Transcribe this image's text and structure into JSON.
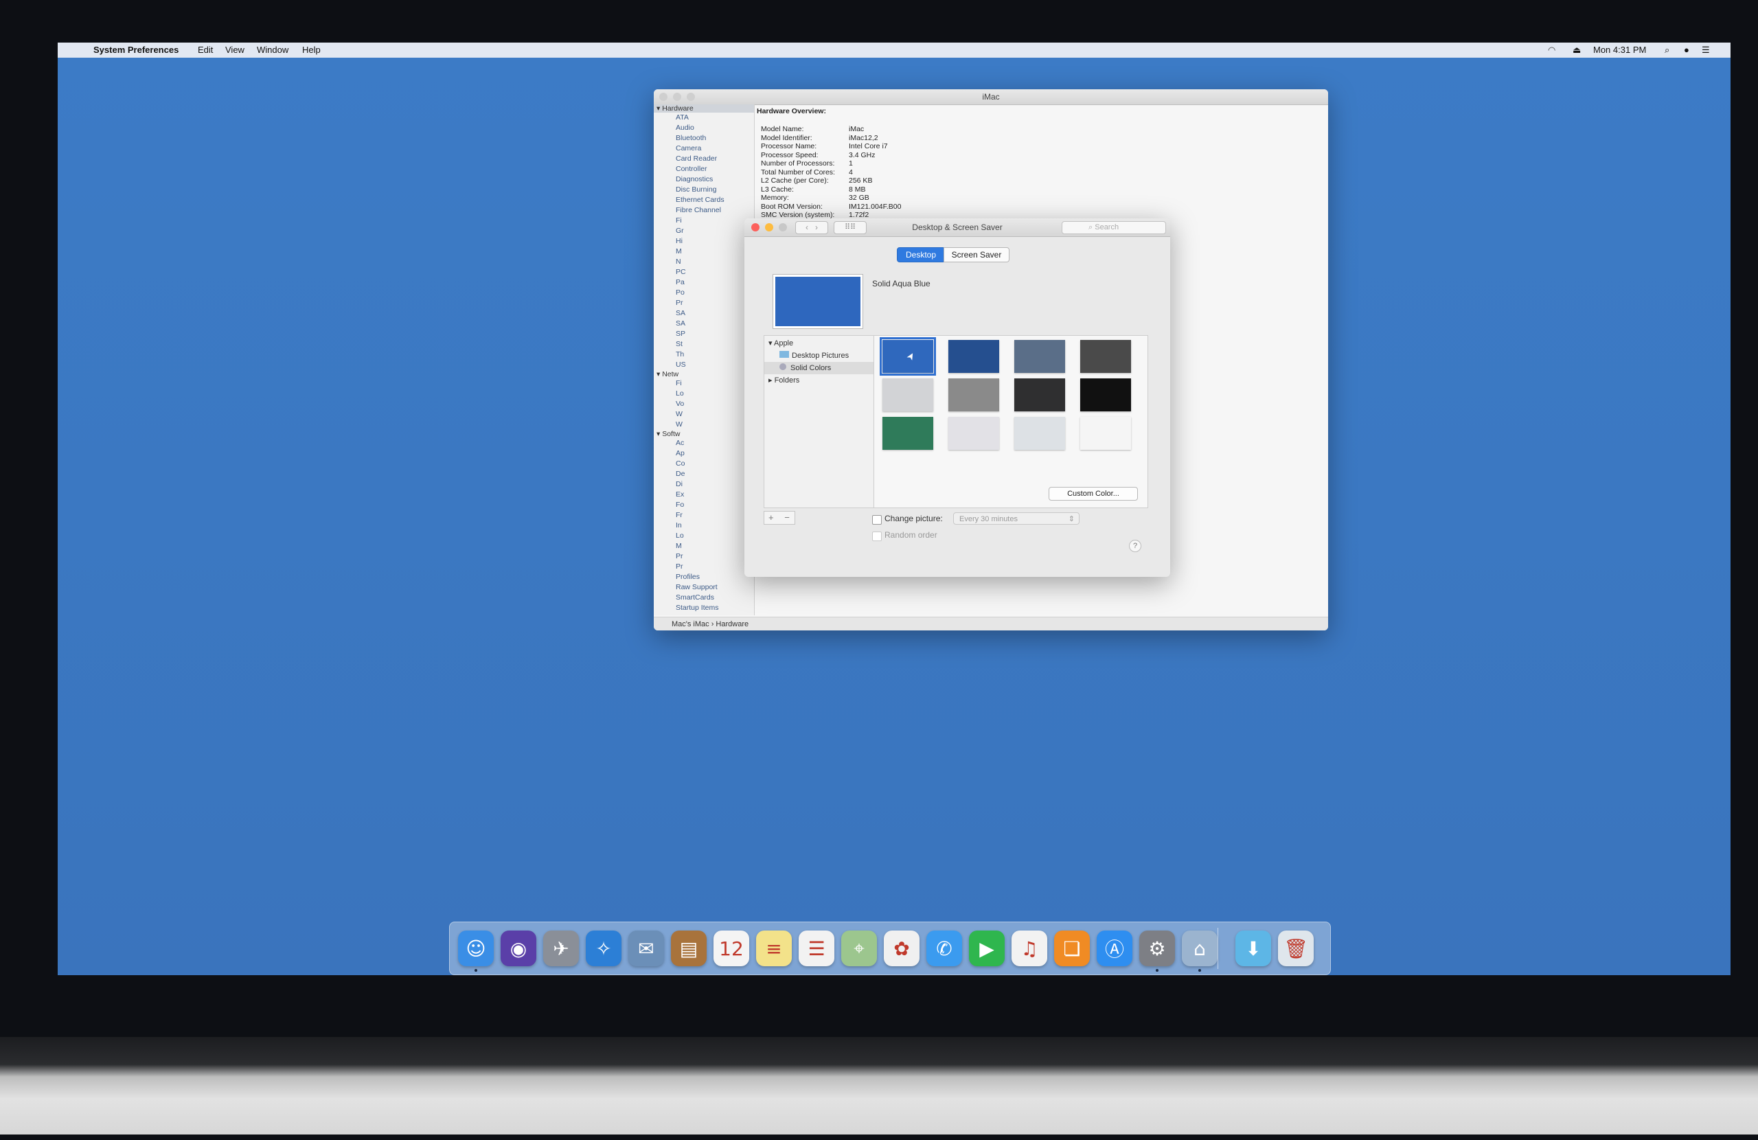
{
  "menubar": {
    "app_name": "System Preferences",
    "menus": [
      "Edit",
      "View",
      "Window",
      "Help"
    ],
    "clock": "Mon 4:31 PM"
  },
  "system_info": {
    "window_title": "iMac",
    "sidebar": {
      "hardware_header": "Hardware",
      "hardware_items": [
        "ATA",
        "Audio",
        "Bluetooth",
        "Camera",
        "Card Reader",
        "Controller",
        "Diagnostics",
        "Disc Burning",
        "Ethernet Cards",
        "Fibre Channel"
      ],
      "network_header": "Netw",
      "software_header": "Softw",
      "software_items_bottom": [
        "Profiles",
        "Raw Support",
        "SmartCards",
        "Startup Items"
      ]
    },
    "overview_title": "Hardware Overview:",
    "specs": [
      {
        "k": "Model Name:",
        "v": "iMac"
      },
      {
        "k": "Model Identifier:",
        "v": "iMac12,2"
      },
      {
        "k": "Processor Name:",
        "v": "Intel Core i7"
      },
      {
        "k": "Processor Speed:",
        "v": "3.4 GHz"
      },
      {
        "k": "Number of Processors:",
        "v": "1"
      },
      {
        "k": "Total Number of Cores:",
        "v": "4"
      },
      {
        "k": "L2 Cache (per Core):",
        "v": "256 KB"
      },
      {
        "k": "L3 Cache:",
        "v": "8 MB"
      },
      {
        "k": "Memory:",
        "v": "32 GB"
      },
      {
        "k": "Boot ROM Version:",
        "v": "IM121.004F.B00"
      },
      {
        "k": "SMC Version (system):",
        "v": "1.72f2"
      }
    ],
    "status_path": "Mac's iMac › Hardware"
  },
  "desktop_prefs": {
    "window_title": "Desktop & Screen Saver",
    "search_placeholder": "Search",
    "tabs": [
      "Desktop",
      "Screen Saver"
    ],
    "selected_name": "Solid Aqua Blue",
    "sources": {
      "apple": "Apple",
      "desktop_pictures": "Desktop Pictures",
      "solid_colors": "Solid Colors",
      "folders": "Folders"
    },
    "swatches": [
      "#2f68bd",
      "#254f8f",
      "#5a6e88",
      "#4a4a4a",
      "#d2d3d6",
      "#8a8a8a",
      "#2f2f30",
      "#111111",
      "#2f7b5a",
      "#e2e1e6",
      "#dde1e5",
      "#f5f5f5"
    ],
    "custom_color_label": "Custom Color...",
    "add_label": "+",
    "remove_label": "−",
    "change_picture_label": "Change picture:",
    "interval_value": "Every 30 minutes",
    "random_order_label": "Random order",
    "help_label": "?"
  },
  "dock": {
    "apps": [
      {
        "icon": "finder-icon",
        "color": "#3a8ee6",
        "glyph": "☺",
        "running": true
      },
      {
        "icon": "siri-icon",
        "color": "#5a3fa8",
        "glyph": "◉",
        "running": false
      },
      {
        "icon": "launchpad-icon",
        "color": "#8a8f98",
        "glyph": "✈",
        "running": false
      },
      {
        "icon": "safari-icon",
        "color": "#2c7fd6",
        "glyph": "✧",
        "running": false
      },
      {
        "icon": "mail-icon",
        "color": "#6b8fb8",
        "glyph": "✉",
        "running": false
      },
      {
        "icon": "contacts-icon",
        "color": "#a8733c",
        "glyph": "▤",
        "running": false
      },
      {
        "icon": "calendar-icon",
        "color": "#f4f4f4",
        "glyph": "12",
        "running": false
      },
      {
        "icon": "notes-icon",
        "color": "#f3e28a",
        "glyph": "≡",
        "running": false
      },
      {
        "icon": "reminders-icon",
        "color": "#f2f2f2",
        "glyph": "☰",
        "running": false
      },
      {
        "icon": "maps-icon",
        "color": "#9cc68e",
        "glyph": "⌖",
        "running": false
      },
      {
        "icon": "photos-icon",
        "color": "#f0f0f0",
        "glyph": "✿",
        "running": false
      },
      {
        "icon": "messages-icon",
        "color": "#3b9bef",
        "glyph": "✆",
        "running": false
      },
      {
        "icon": "facetime-icon",
        "color": "#2fb64e",
        "glyph": "▶",
        "running": false
      },
      {
        "icon": "itunes-icon",
        "color": "#f2f2f2",
        "glyph": "♫",
        "running": false
      },
      {
        "icon": "ibooks-icon",
        "color": "#f08b24",
        "glyph": "❏",
        "running": false
      },
      {
        "icon": "app-store-icon",
        "color": "#2e8ef0",
        "glyph": "Ⓐ",
        "running": false
      },
      {
        "icon": "system-preferences-icon",
        "color": "#7d7f85",
        "glyph": "⚙",
        "running": true
      },
      {
        "icon": "system-information-icon",
        "color": "#9bb4cf",
        "glyph": "⌂",
        "running": true
      },
      {
        "icon": "downloads-folder-icon",
        "color": "#5db6e6",
        "glyph": "⬇",
        "running": false
      },
      {
        "icon": "trash-icon",
        "color": "#dfe6ec",
        "glyph": "🗑",
        "running": false
      }
    ]
  },
  "colors": {
    "desktop_blue": "#3b78c2",
    "selection_blue": "#2f6fd0",
    "close": "#fc605c",
    "minimize": "#fdbc40",
    "zoom": "#34c84a"
  }
}
